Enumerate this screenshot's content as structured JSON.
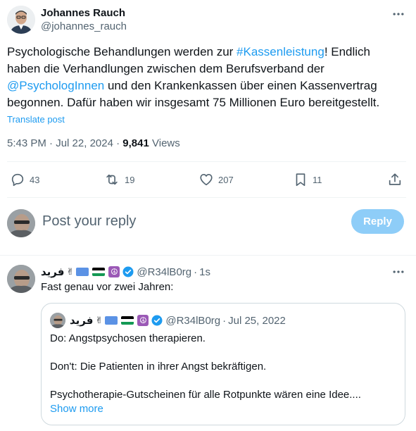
{
  "post": {
    "author_name": "Johannes Rauch",
    "author_handle": "@johannes_rauch",
    "text_part1": "Psychologische Behandlungen werden zur ",
    "hashtag": "#Kassenleistung",
    "text_part2": "! Endlich haben die Verhandlungen zwischen dem Berufsverband der ",
    "mention": "@PsychologInnen",
    "text_part3": " und den Krankenkassen über einen Kassenvertrag begonnen. Dafür haben wir insgesamt 75 Millionen Euro bereitgestellt.",
    "translate_label": "Translate post",
    "time": "5:43 PM",
    "date": "Jul 22, 2024",
    "views_count": "9,841",
    "views_label": "Views",
    "separator": "·"
  },
  "actions": {
    "replies": "43",
    "reposts": "19",
    "likes": "207",
    "bookmarks": "11"
  },
  "reply_box": {
    "placeholder": "Post your reply",
    "button_label": "Reply"
  },
  "reply": {
    "author_name": "فريد",
    "author_handle": "@R34lB0rg",
    "time": "1s",
    "text": "Fast genau vor zwei Jahren:"
  },
  "quote": {
    "author_name": "فريد",
    "author_handle": "@R34lB0rg",
    "date": "Jul 25, 2022",
    "line1": "Do: Angstpsychosen therapieren.",
    "line2": "Don't: Die Patienten in ihrer Angst bekräftigen.",
    "line3": "Psychotherapie-Gutscheinen für alle Rotpunkte wären eine Idee....",
    "show_more": "Show more"
  },
  "icons": {
    "more": "more-horizontal-icon",
    "reply": "reply-icon",
    "repost": "repost-icon",
    "like": "heart-icon",
    "bookmark": "bookmark-icon",
    "share": "share-icon",
    "verified": "verified-badge-icon"
  },
  "colors": {
    "accent": "#1d9bf0",
    "muted": "#536471",
    "reply_button_disabled": "#8ecdf8",
    "divider": "#eff3f4"
  }
}
